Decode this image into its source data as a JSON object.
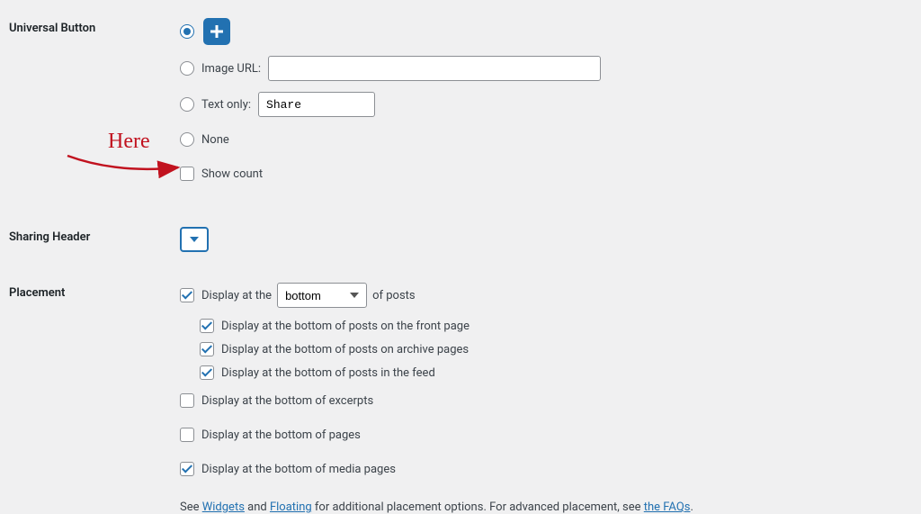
{
  "annotation": {
    "label": "Here"
  },
  "universal_button": {
    "section_label": "Universal Button",
    "options": {
      "image_url_label": "Image URL:",
      "image_url_value": "",
      "text_only_label": "Text only:",
      "text_only_value": "Share",
      "none_label": "None"
    },
    "show_count_label": "Show count"
  },
  "sharing_header": {
    "section_label": "Sharing Header"
  },
  "placement": {
    "section_label": "Placement",
    "display_at_prefix": "Display at the",
    "display_at_suffix": "of posts",
    "position_value": "bottom",
    "sub": {
      "front_page": "Display at the bottom of posts on the front page",
      "archive": "Display at the bottom of posts on archive pages",
      "feed": "Display at the bottom of posts in the feed"
    },
    "excerpts": "Display at the bottom of excerpts",
    "pages": "Display at the bottom of pages",
    "media": "Display at the bottom of media pages",
    "hint_prefix": "See ",
    "hint_widgets": "Widgets",
    "hint_and": " and ",
    "hint_floating": "Floating",
    "hint_mid": " for additional placement options. For advanced placement, see ",
    "hint_faqs": "the FAQs",
    "hint_suffix": "."
  }
}
